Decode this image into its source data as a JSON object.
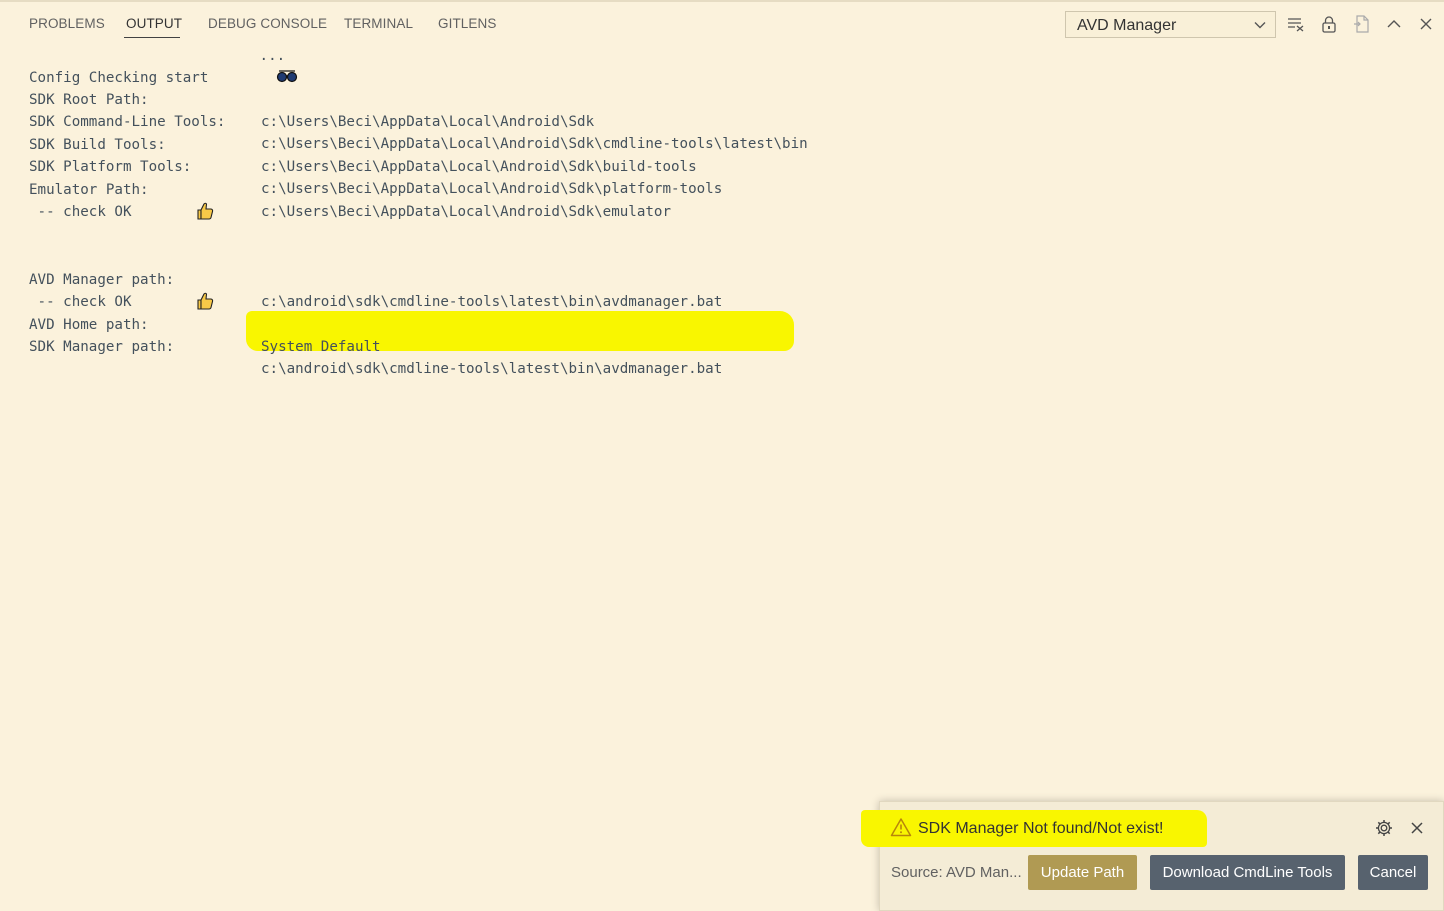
{
  "panel": {
    "tabs": [
      {
        "label": "PROBLEMS"
      },
      {
        "label": "OUTPUT"
      },
      {
        "label": "DEBUG CONSOLE"
      },
      {
        "label": "TERMINAL"
      },
      {
        "label": "GITLENS"
      }
    ],
    "active_tab": "OUTPUT",
    "channel_select": {
      "value": "AVD Manager"
    },
    "toolbar_icons": [
      "clear-output-icon",
      "lock-scroll-icon",
      "open-in-editor-icon",
      "maximize-panel-icon",
      "close-panel-icon"
    ]
  },
  "output": {
    "lines": [
      {
        "key": "Config Checking start",
        "value": "",
        "emoji": "glasses",
        "suffix": " ..."
      },
      {
        "key": "SDK Root Path:",
        "value": "c:\\Users\\Beci\\AppData\\Local\\Android\\Sdk"
      },
      {
        "key": "SDK Command-Line Tools:",
        "value": "c:\\Users\\Beci\\AppData\\Local\\Android\\Sdk\\cmdline-tools\\latest\\bin"
      },
      {
        "key": "SDK Build Tools:",
        "value": "c:\\Users\\Beci\\AppData\\Local\\Android\\Sdk\\build-tools"
      },
      {
        "key": "SDK Platform Tools:",
        "value": "c:\\Users\\Beci\\AppData\\Local\\Android\\Sdk\\platform-tools"
      },
      {
        "key": "Emulator Path:",
        "value": "c:\\Users\\Beci\\AppData\\Local\\Android\\Sdk\\emulator"
      },
      {
        "key": " -- check OK",
        "value": "",
        "emoji": "thumbs-up"
      },
      {
        "key": "AVD Manager path:",
        "value": "c:\\android\\sdk\\cmdline-tools\\latest\\bin\\avdmanager.bat"
      },
      {
        "key": " -- check OK",
        "value": "",
        "emoji": "thumbs-up"
      },
      {
        "key": "AVD Home path:",
        "value": "System Default"
      },
      {
        "key": "SDK Manager path:",
        "value": "c:\\android\\sdk\\cmdline-tools\\latest\\bin\\avdmanager.bat"
      }
    ]
  },
  "notification": {
    "message": "SDK Manager Not found/Not exist!",
    "source": "Source: AVD Man...",
    "buttons": {
      "update": "Update Path",
      "download": "Download CmdLine Tools",
      "cancel": "Cancel"
    },
    "icons": [
      "warning-icon",
      "gear-icon",
      "close-icon"
    ]
  },
  "colors": {
    "background": "#fbf2dc",
    "highlight": "#f9f600",
    "primary_button": "#b09a53",
    "secondary_button": "#57626e"
  }
}
